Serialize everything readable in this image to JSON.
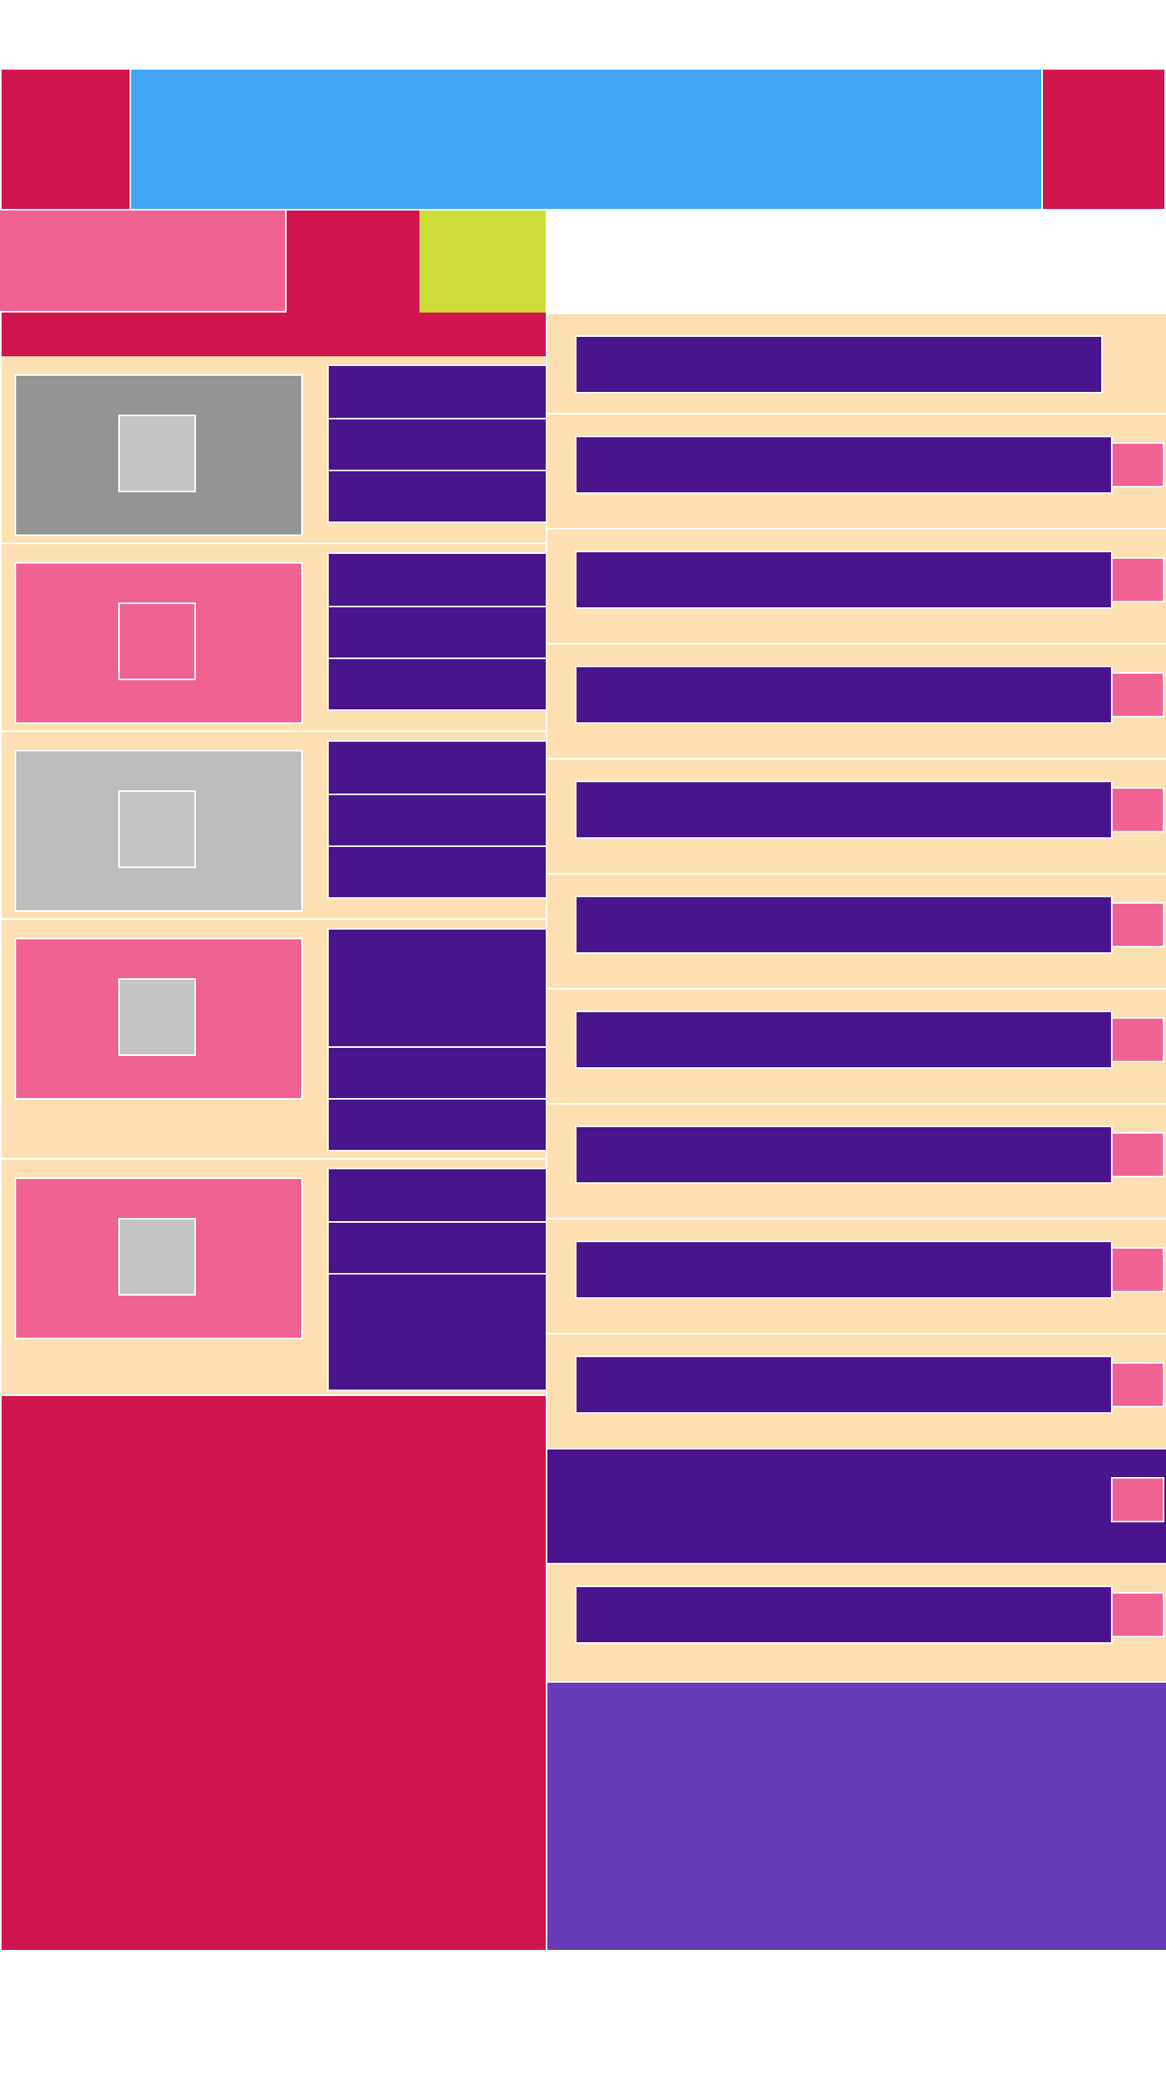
{
  "colors": {
    "primary": "#d1154f",
    "app_bar": "#42a5f5",
    "accent_pink": "#f06292",
    "accent_lime": "#cddc39",
    "surface": "#fde0b2",
    "text_block": "#4a148c",
    "footer_panel": "#673ab7",
    "placeholder_gray": "#949494",
    "placeholder_light": "#bdbdbd",
    "icon_placeholder": "#c4c4c4"
  },
  "app_bar": {
    "left_icon": "menu-icon",
    "right_icon": "overflow-icon",
    "title": ""
  },
  "tabs": {
    "items": [
      {
        "label": "",
        "color": "#f06292"
      },
      {
        "label": "",
        "color": "#d1154f"
      },
      {
        "label": "",
        "color": "#cddc39"
      }
    ]
  },
  "cards": {
    "items": [
      {
        "thumb_color": "#949494",
        "icon": "image-icon",
        "line1": "",
        "line2": "",
        "line3": ""
      },
      {
        "thumb_color": "#f06292",
        "icon": "image-icon",
        "line1": "",
        "line2": "",
        "line3": ""
      },
      {
        "thumb_color": "#bdbdbd",
        "icon": "image-icon",
        "line1": "",
        "line2": "",
        "line3": ""
      },
      {
        "thumb_color": "#f06292",
        "icon": "image-icon",
        "line1": "",
        "line2": "",
        "line3": ""
      },
      {
        "thumb_color": "#f06292",
        "icon": "image-icon",
        "line1": "",
        "line2": "",
        "line3": ""
      }
    ]
  },
  "list": {
    "items": [
      {
        "text": "",
        "has_badge": false
      },
      {
        "text": "",
        "has_badge": true
      },
      {
        "text": "",
        "has_badge": true
      },
      {
        "text": "",
        "has_badge": true
      },
      {
        "text": "",
        "has_badge": true
      },
      {
        "text": "",
        "has_badge": true
      },
      {
        "text": "",
        "has_badge": true
      },
      {
        "text": "",
        "has_badge": true
      },
      {
        "text": "",
        "has_badge": true
      },
      {
        "text": "",
        "has_badge": true
      },
      {
        "text": "",
        "has_badge": true,
        "selected": true
      },
      {
        "text": "",
        "has_badge": true
      }
    ]
  }
}
